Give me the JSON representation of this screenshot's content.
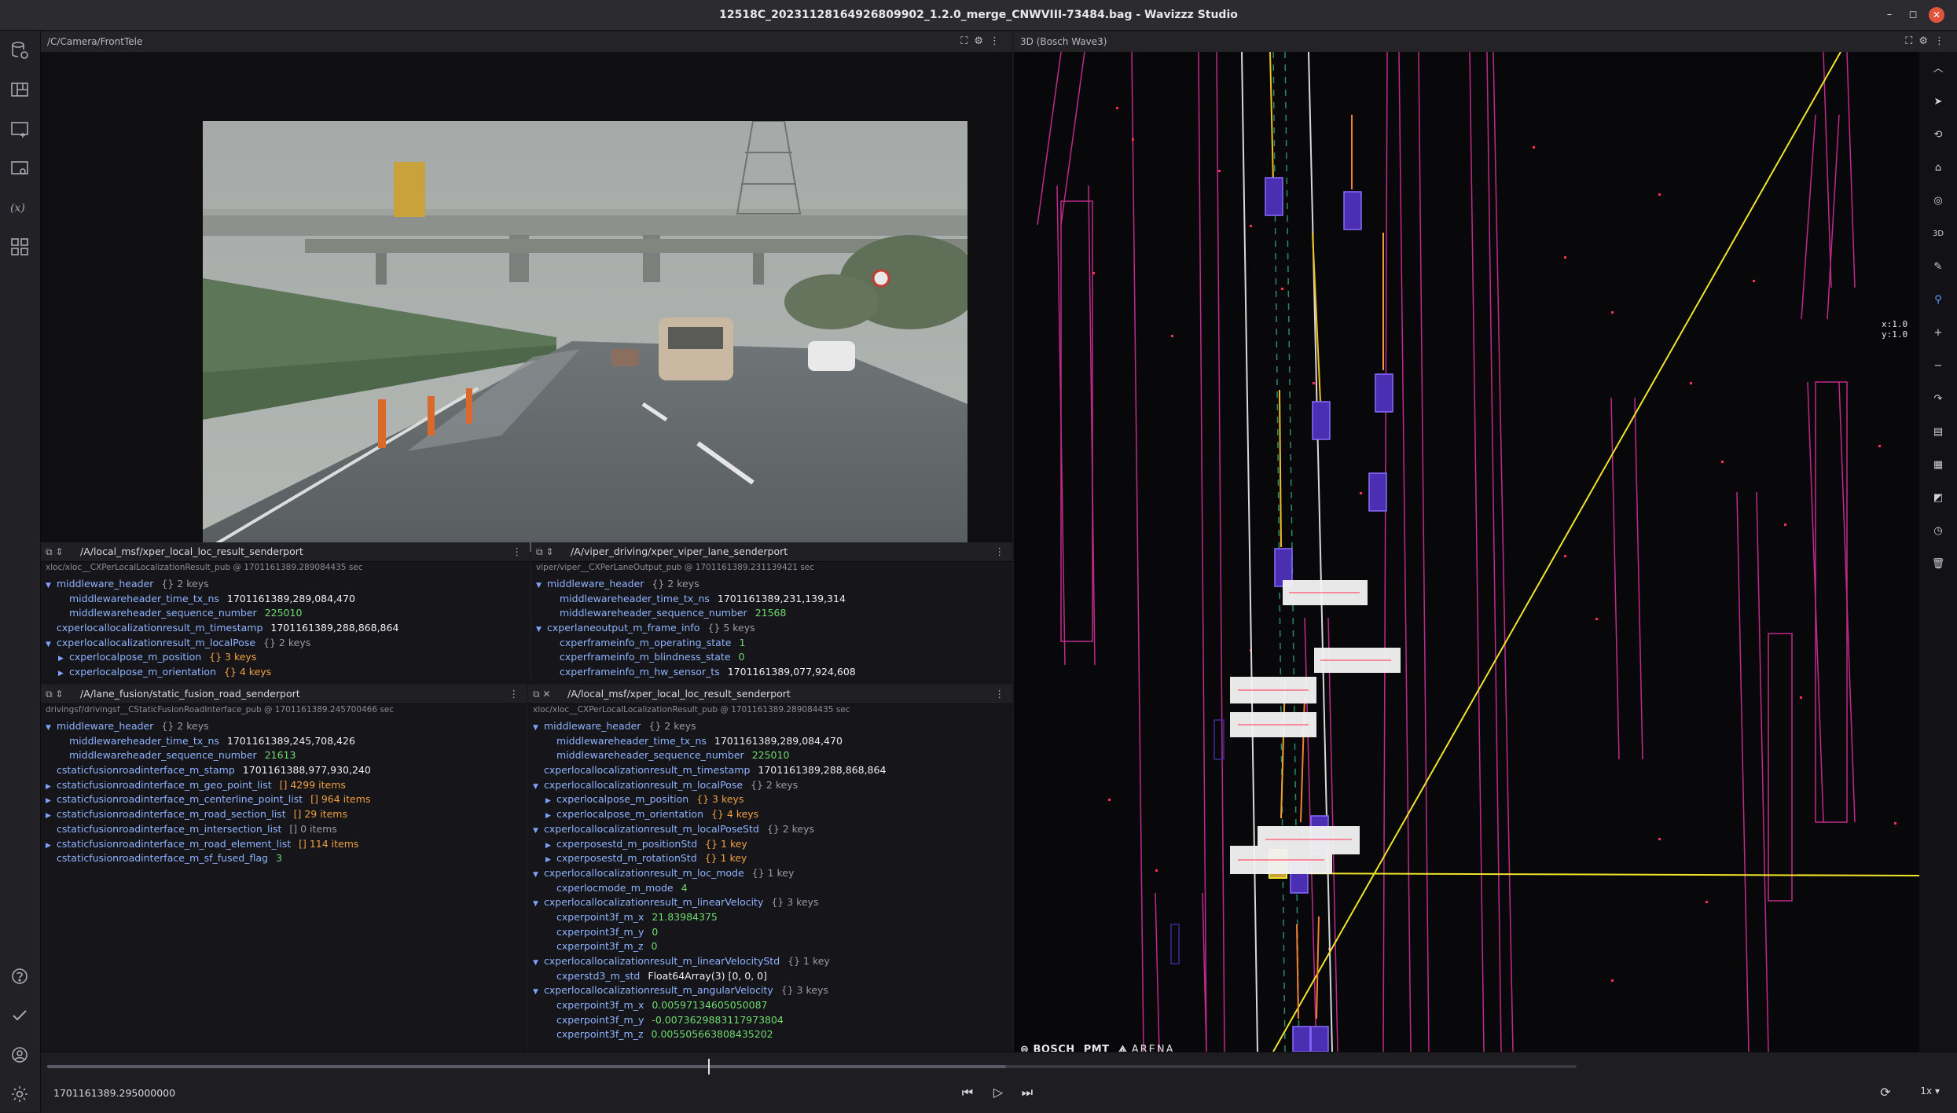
{
  "window": {
    "title": "12518C_20231128164926809902_1.2.0_merge_CNWVIII-73484.bag - Wavizzz Studio",
    "controls": [
      "–",
      "◻",
      "✕"
    ]
  },
  "rail": {
    "top_icons": [
      "data-source-icon",
      "layout-icon",
      "panel-add-icon",
      "panel-settings-icon",
      "variables-icon",
      "extensions-icon"
    ],
    "bottom_icons": [
      "help-icon",
      "check-icon",
      "account-icon",
      "settings-icon"
    ]
  },
  "camera_panel": {
    "title": "/C/Camera/FrontTele"
  },
  "view3d_panel": {
    "title": "3D (Bosch Wave3)",
    "coord_x": "x:1.0",
    "coord_y": "y:1.0",
    "logos": {
      "bosch": "BOSCH",
      "pmt": "PMT",
      "arena": "ARENA"
    },
    "tools": [
      "chevron-up-icon",
      "select-icon",
      "rotate-icon",
      "mouse-icon",
      "inspect-icon",
      "3d-icon",
      "ruler-icon",
      "pin-icon",
      "zoom-in-icon",
      "zoom-out-icon",
      "reset-icon",
      "map-icon",
      "grid-icon",
      "layer-icon",
      "clock-icon",
      "trash-icon"
    ],
    "tool_labels": {
      "three_d": "3D"
    }
  },
  "msg1": {
    "topic": "/A/local_msf/xper_local_loc_result_senderport",
    "sub": "xloc/xloc__CXPerLocalLocalizationResult_pub @ 1701161389.289084435 sec",
    "rows": [
      {
        "arrow": "▼",
        "indent": 0,
        "key": "middleware_header",
        "val": "",
        "meta": "{} 2 keys"
      },
      {
        "arrow": "",
        "indent": 1,
        "key": "middlewareheader_time_tx_ns",
        "val": "1701161389,289,084,470"
      },
      {
        "arrow": "",
        "indent": 1,
        "key": "middlewareheader_sequence_number",
        "val": "225010",
        "green": true
      },
      {
        "arrow": "",
        "indent": 0,
        "key": "cxperlocallocalizationresult_m_timestamp",
        "val": "1701161389,288,868,864"
      },
      {
        "arrow": "▼",
        "indent": 0,
        "key": "cxperlocallocalizationresult_m_localPose",
        "val": "",
        "meta": "{} 2 keys"
      },
      {
        "arrow": "▶",
        "indent": 1,
        "key": "cxperlocalpose_m_position",
        "val": "",
        "orange": "{} 3 keys"
      },
      {
        "arrow": "▶",
        "indent": 1,
        "key": "cxperlocalpose_m_orientation",
        "val": "",
        "orange": "{} 4 keys"
      }
    ]
  },
  "msg2": {
    "topic": "/A/viper_driving/xper_viper_lane_senderport",
    "sub": "viper/viper__CXPerLaneOutput_pub @ 1701161389.231139421 sec",
    "rows": [
      {
        "arrow": "▼",
        "indent": 0,
        "key": "middleware_header",
        "val": "",
        "meta": "{} 2 keys"
      },
      {
        "arrow": "",
        "indent": 1,
        "key": "middlewareheader_time_tx_ns",
        "val": "1701161389,231,139,314"
      },
      {
        "arrow": "",
        "indent": 1,
        "key": "middlewareheader_sequence_number",
        "val": "21568",
        "green": true
      },
      {
        "arrow": "▼",
        "indent": 0,
        "key": "cxperlaneoutput_m_frame_info",
        "val": "",
        "meta": "{} 5 keys"
      },
      {
        "arrow": "",
        "indent": 1,
        "key": "cxperframeinfo_m_operating_state",
        "val": "1",
        "green": true
      },
      {
        "arrow": "",
        "indent": 1,
        "key": "cxperframeinfo_m_blindness_state",
        "val": "0",
        "green": true
      },
      {
        "arrow": "",
        "indent": 1,
        "key": "cxperframeinfo_m_hw_sensor_ts",
        "val": "1701161389,077,924,608"
      }
    ]
  },
  "msg3": {
    "topic": "/A/lane_fusion/static_fusion_road_senderport",
    "sub": "drivingsf/drivingsf__CStaticFusionRoadInterface_pub @ 1701161389.245700466 sec",
    "rows": [
      {
        "arrow": "▼",
        "indent": 0,
        "key": "middleware_header",
        "val": "",
        "meta": "{} 2 keys"
      },
      {
        "arrow": "",
        "indent": 1,
        "key": "middlewareheader_time_tx_ns",
        "val": "1701161389,245,708,426"
      },
      {
        "arrow": "",
        "indent": 1,
        "key": "middlewareheader_sequence_number",
        "val": "21613",
        "green": true
      },
      {
        "arrow": "",
        "indent": 0,
        "key": "cstaticfusionroadinterface_m_stamp",
        "val": "1701161388,977,930,240"
      },
      {
        "arrow": "▶",
        "indent": 0,
        "key": "cstaticfusionroadinterface_m_geo_point_list",
        "val": "",
        "orange": "[] 4299 items"
      },
      {
        "arrow": "▶",
        "indent": 0,
        "key": "cstaticfusionroadinterface_m_centerline_point_list",
        "val": "",
        "orange": "[] 964 items"
      },
      {
        "arrow": "▶",
        "indent": 0,
        "key": "cstaticfusionroadinterface_m_road_section_list",
        "val": "",
        "orange": "[] 29 items"
      },
      {
        "arrow": "",
        "indent": 0,
        "key": "cstaticfusionroadinterface_m_intersection_list",
        "val": "",
        "meta": "[] 0 items"
      },
      {
        "arrow": "▶",
        "indent": 0,
        "key": "cstaticfusionroadinterface_m_road_element_list",
        "val": "",
        "orange": "[] 114 items"
      },
      {
        "arrow": "",
        "indent": 0,
        "key": "cstaticfusionroadinterface_m_sf_fused_flag",
        "val": "3",
        "green": true
      }
    ]
  },
  "msg4": {
    "topic": "/A/local_msf/xper_local_loc_result_senderport",
    "sub": "xloc/xloc__CXPerLocalLocalizationResult_pub @ 1701161389.289084435 sec",
    "rows": [
      {
        "arrow": "▼",
        "indent": 0,
        "key": "middleware_header",
        "val": "",
        "meta": "{} 2 keys"
      },
      {
        "arrow": "",
        "indent": 1,
        "key": "middlewareheader_time_tx_ns",
        "val": "1701161389,289,084,470"
      },
      {
        "arrow": "",
        "indent": 1,
        "key": "middlewareheader_sequence_number",
        "val": "225010",
        "green": true
      },
      {
        "arrow": "",
        "indent": 0,
        "key": "cxperlocallocalizationresult_m_timestamp",
        "val": "1701161389,288,868,864"
      },
      {
        "arrow": "▼",
        "indent": 0,
        "key": "cxperlocallocalizationresult_m_localPose",
        "val": "",
        "meta": "{} 2 keys"
      },
      {
        "arrow": "▶",
        "indent": 1,
        "key": "cxperlocalpose_m_position",
        "val": "",
        "orange": "{} 3 keys"
      },
      {
        "arrow": "▶",
        "indent": 1,
        "key": "cxperlocalpose_m_orientation",
        "val": "",
        "orange": "{} 4 keys"
      },
      {
        "arrow": "▼",
        "indent": 0,
        "key": "cxperlocallocalizationresult_m_localPoseStd",
        "val": "",
        "meta": "{} 2 keys"
      },
      {
        "arrow": "▶",
        "indent": 1,
        "key": "cxperposestd_m_positionStd",
        "val": "",
        "orange": "{} 1 key"
      },
      {
        "arrow": "▶",
        "indent": 1,
        "key": "cxperposestd_m_rotationStd",
        "val": "",
        "orange": "{} 1 key"
      },
      {
        "arrow": "▼",
        "indent": 0,
        "key": "cxperlocallocalizationresult_m_loc_mode",
        "val": "",
        "meta": "{} 1 key"
      },
      {
        "arrow": "",
        "indent": 1,
        "key": "cxperlocmode_m_mode",
        "val": "4",
        "green": true
      },
      {
        "arrow": "▼",
        "indent": 0,
        "key": "cxperlocallocalizationresult_m_linearVelocity",
        "val": "",
        "meta": "{} 3 keys"
      },
      {
        "arrow": "",
        "indent": 1,
        "key": "cxperpoint3f_m_x",
        "val": "21.83984375",
        "green": true
      },
      {
        "arrow": "",
        "indent": 1,
        "key": "cxperpoint3f_m_y",
        "val": "0",
        "green": true
      },
      {
        "arrow": "",
        "indent": 1,
        "key": "cxperpoint3f_m_z",
        "val": "0",
        "green": true
      },
      {
        "arrow": "▼",
        "indent": 0,
        "key": "cxperlocallocalizationresult_m_linearVelocityStd",
        "val": "",
        "meta": "{} 1 key"
      },
      {
        "arrow": "",
        "indent": 1,
        "key": "cxperstd3_m_std",
        "val": "Float64Array(3) [0, 0, 0]"
      },
      {
        "arrow": "▼",
        "indent": 0,
        "key": "cxperlocallocalizationresult_m_angularVelocity",
        "val": "",
        "meta": "{} 3 keys"
      },
      {
        "arrow": "",
        "indent": 1,
        "key": "cxperpoint3f_m_x",
        "val": "0.00597134605050087",
        "green": true
      },
      {
        "arrow": "",
        "indent": 1,
        "key": "cxperpoint3f_m_y",
        "val": "-0.0073629883117973804",
        "green": true
      },
      {
        "arrow": "",
        "indent": 1,
        "key": "cxperpoint3f_m_z",
        "val": "0.005505663808435202",
        "green": true
      }
    ]
  },
  "playbar": {
    "timestamp": "1701161389.295000000",
    "speed": "1x",
    "progress": 0.432,
    "buffered": 0.627
  }
}
